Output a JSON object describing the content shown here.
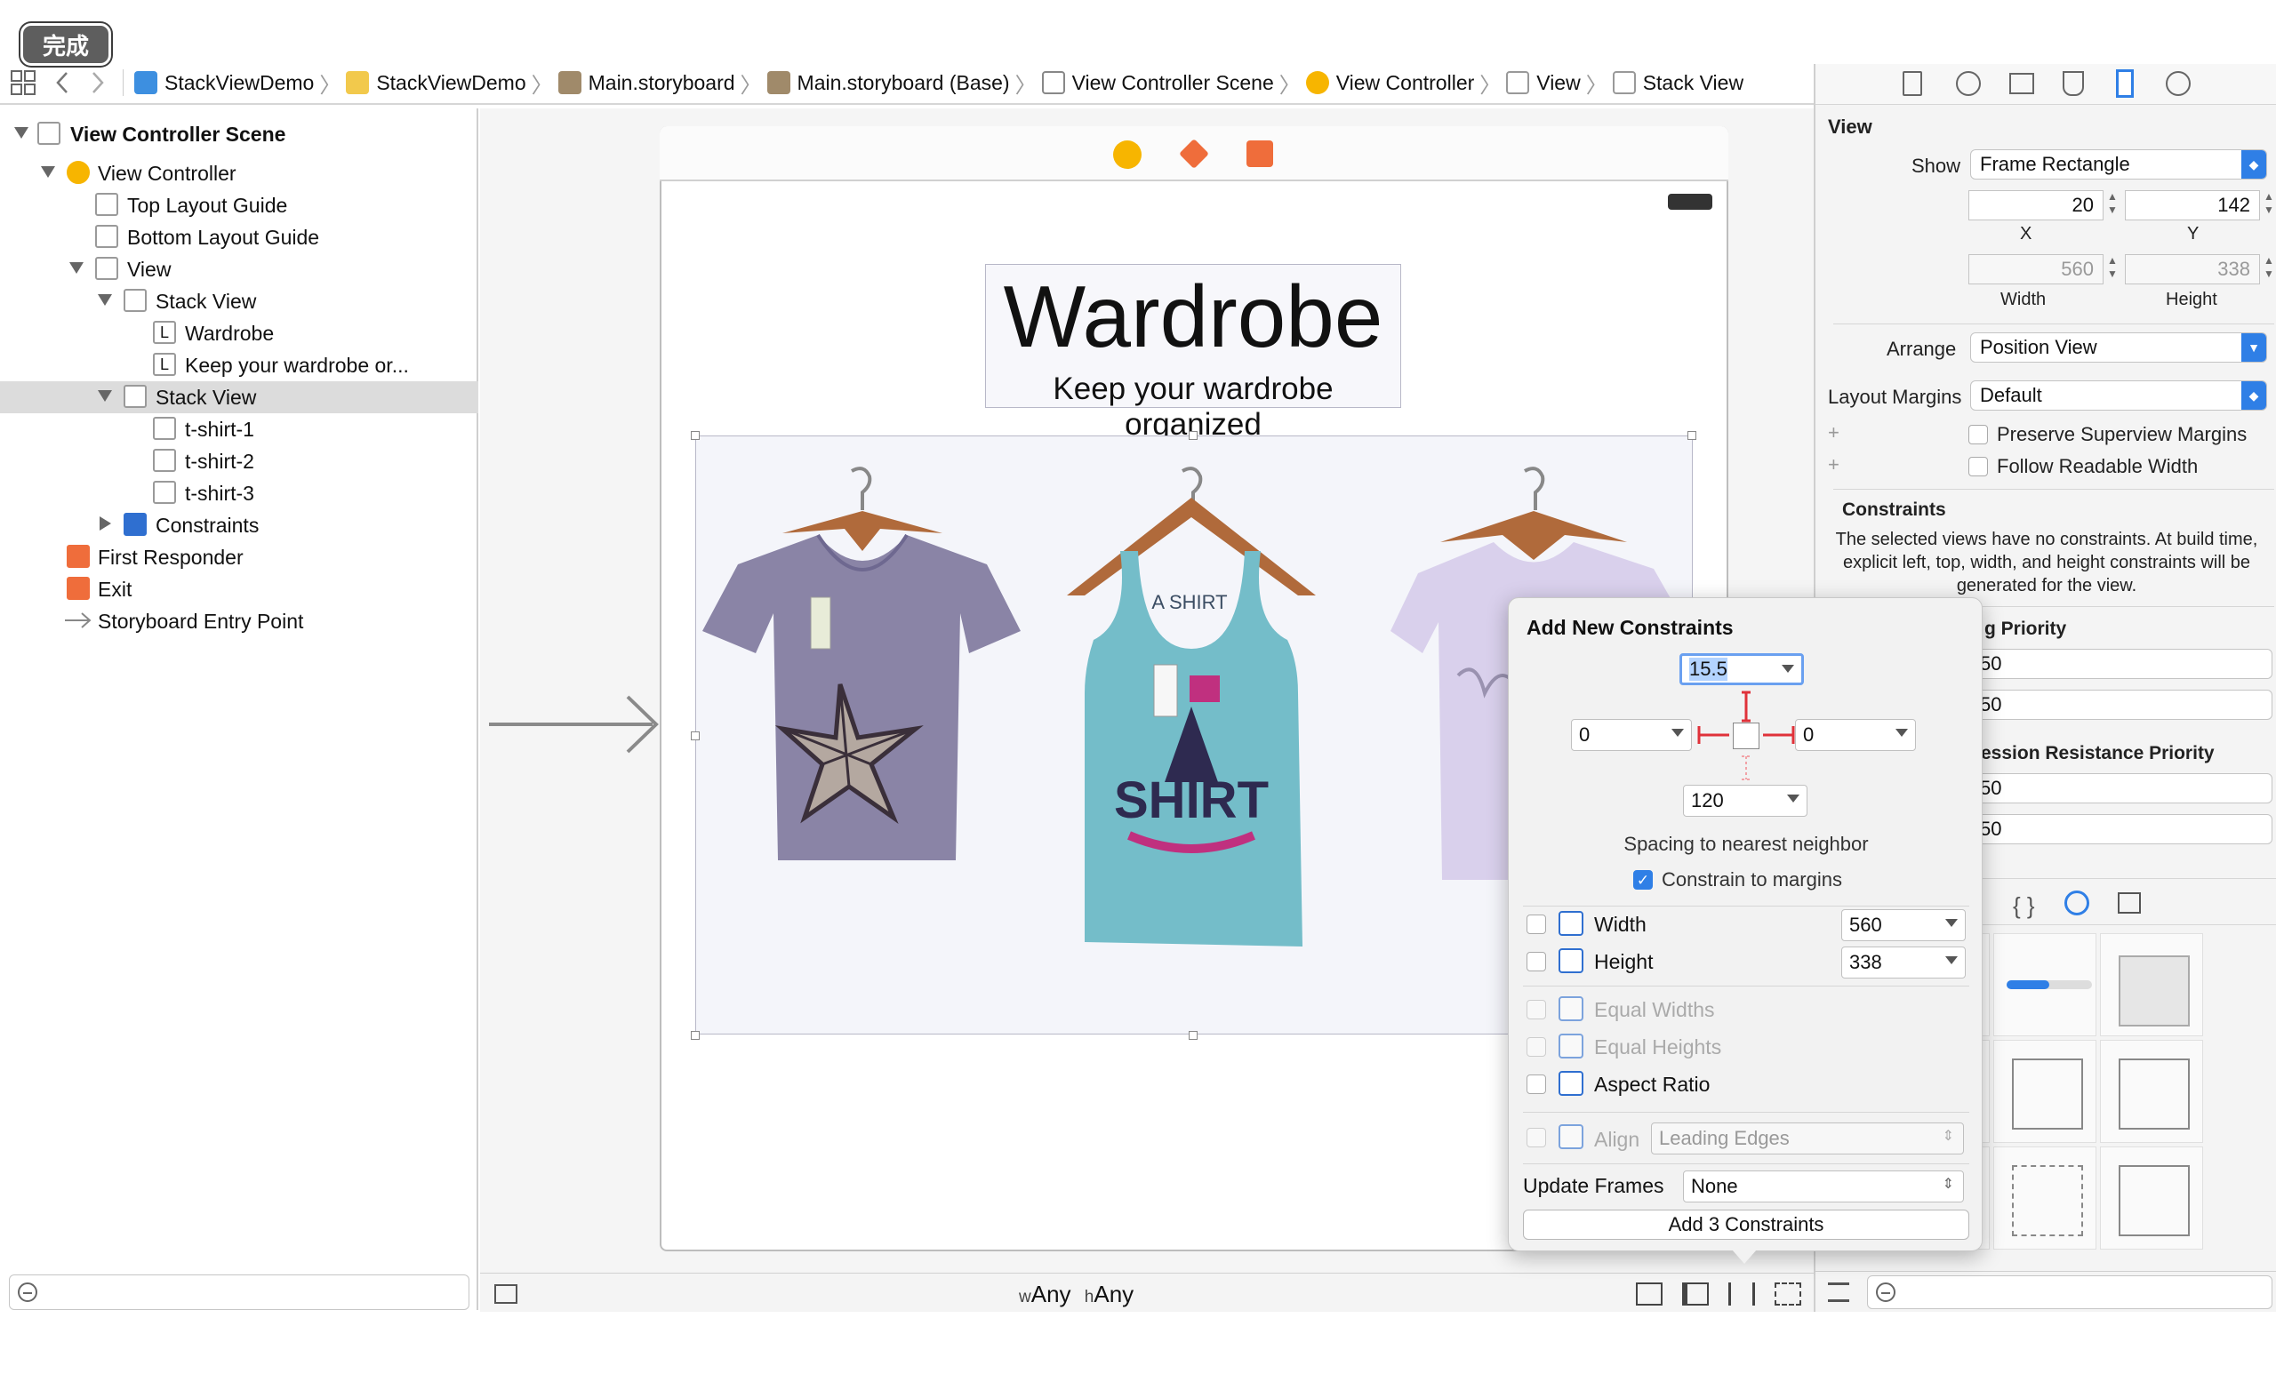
{
  "done_button": "完成",
  "breadcrumb": [
    "StackViewDemo",
    "StackViewDemo",
    "Main.storyboard",
    "Main.storyboard (Base)",
    "View Controller Scene",
    "View Controller",
    "View",
    "Stack View"
  ],
  "navigator": {
    "items": [
      {
        "label": "View Controller Scene",
        "bold": true
      },
      {
        "label": "View Controller"
      },
      {
        "label": "Top Layout Guide"
      },
      {
        "label": "Bottom Layout Guide"
      },
      {
        "label": "View"
      },
      {
        "label": "Stack View"
      },
      {
        "label": "Wardrobe"
      },
      {
        "label": "Keep your wardrobe or..."
      },
      {
        "label": "Stack View",
        "selected": true
      },
      {
        "label": "t-shirt-1"
      },
      {
        "label": "t-shirt-2"
      },
      {
        "label": "t-shirt-3"
      },
      {
        "label": "Constraints"
      },
      {
        "label": "First Responder"
      },
      {
        "label": "Exit"
      },
      {
        "label": "Storyboard Entry Point"
      }
    ],
    "label_l": "L"
  },
  "canvas": {
    "title": "Wardrobe",
    "subtitle": "Keep your wardrobe organized",
    "size_class_w": "w",
    "size_class_w_val": "Any",
    "size_class_h": "h",
    "size_class_h_val": "Any",
    "shirt2_print": "SHIRT",
    "shirt2_top": "A SHIRT"
  },
  "inspector": {
    "section": "View",
    "show_label": "Show",
    "show_value": "Frame Rectangle",
    "x_value": "20",
    "y_value": "142",
    "x_label": "X",
    "y_label": "Y",
    "width_value": "560",
    "height_value": "338",
    "width_label": "Width",
    "height_label": "Height",
    "arrange_label": "Arrange",
    "arrange_value": "Position View",
    "margins_label": "Layout Margins",
    "margins_value": "Default",
    "preserve": "Preserve Superview Margins",
    "readable": "Follow Readable Width",
    "constraints_title": "Constraints",
    "constraints_text": "The selected views have no constraints. At build time, explicit left, top, width, and height constraints will be generated for the view.",
    "hugging": "g Priority",
    "hug_h": "50",
    "hug_v": "50",
    "compression": "ession Resistance Priority",
    "comp_h": "50",
    "comp_v": "50"
  },
  "popover": {
    "title": "Add New Constraints",
    "top": "15.5",
    "left": "0",
    "right": "0",
    "bottom": "120",
    "spacing": "Spacing to nearest neighbor",
    "constrain_margins": "Constrain to margins",
    "width_label": "Width",
    "width_value": "560",
    "height_label": "Height",
    "height_value": "338",
    "equal_widths": "Equal Widths",
    "equal_heights": "Equal Heights",
    "aspect": "Aspect Ratio",
    "align_label": "Align",
    "align_value": "Leading Edges",
    "update_label": "Update Frames",
    "update_value": "None",
    "add_button": "Add 3 Constraints"
  },
  "colors": {
    "accent": "#2f7fe6",
    "vc_yellow": "#f7b500",
    "orange": "#ef6d3b",
    "shirt1": "#8a84a6",
    "shirt2": "#74bdc9",
    "shirt3": "#d9d0ec",
    "hanger": "#b06a3b",
    "constraint_red": "#e0323a"
  }
}
